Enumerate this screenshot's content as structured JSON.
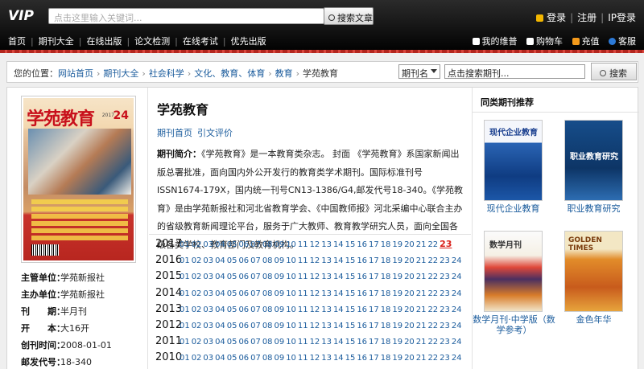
{
  "header": {
    "logo_text": "VIP",
    "search_placeholder": "点击这里输入关键词...",
    "search_button": "搜索文章",
    "login": "登录",
    "register": "注册",
    "ip_login": "IP登录"
  },
  "nav": {
    "items": [
      "首页",
      "期刊大全",
      "在线出版",
      "论文检测",
      "在线考试",
      "优先出版"
    ],
    "right": [
      "我的维普",
      "购物车",
      "充值",
      "客服"
    ],
    "right_icon_colors": [
      "#ffffff",
      "#ffffff",
      "#f59a1b",
      "#2c79d6"
    ]
  },
  "breadcrumb": {
    "prefix": "您的位置：",
    "links": [
      "网站首页",
      "期刊大全",
      "社会科学",
      "文化、教育、体育",
      "教育"
    ],
    "current": "学苑教育"
  },
  "search2": {
    "select_value": "期刊名",
    "input_value": "点击搜索期刊...",
    "button": "搜索"
  },
  "cover": {
    "title": "学苑教育",
    "issue_number": "24",
    "year": "2017"
  },
  "meta": [
    {
      "key": "主管单位：",
      "value": "学苑新报社"
    },
    {
      "key": "主办单位：",
      "value": "学苑新报社"
    },
    {
      "key": "刊　　期：",
      "value": "半月刊"
    },
    {
      "key": "开　　本：",
      "value": "大16开"
    },
    {
      "key": "创刊时间：",
      "value": "2008-01-01"
    },
    {
      "key": "邮发代号：",
      "value": "18-340"
    }
  ],
  "journal": {
    "title": "学苑教育",
    "link_home": "期刊首页",
    "link_cite": "引文评价",
    "intro_label": "期刊简介：",
    "intro_text": "《学苑教育》是一本教育类杂志。 封面 《学苑教育》系国家新闻出版总署批准，面向国内外公开发行的教育类学术期刊。国际标准刊号ISSN1674-179X，国内统一刊号CN13-1386/G4,邮发代号18-340。《学苑教育》是由学苑新报社和河北省教育学会、《中国教师报》河北采编中心联合主办的省级教育新闻理论平台，服务于广大教师、教育教学研究人员，面向全国各级各类学校、教育部门及教育机构。"
  },
  "years": [
    {
      "year": "2017",
      "issues": [
        "01",
        "02",
        "03",
        "04",
        "05",
        "06",
        "07",
        "08",
        "09",
        "10",
        "11",
        "12",
        "13",
        "14",
        "15",
        "16",
        "17",
        "18",
        "19",
        "20",
        "21",
        "22",
        "23"
      ],
      "current": "23"
    },
    {
      "year": "2016",
      "issues": [
        "01",
        "02",
        "03",
        "04",
        "05",
        "06",
        "07",
        "08",
        "09",
        "10",
        "11",
        "12",
        "13",
        "14",
        "15",
        "16",
        "17",
        "18",
        "19",
        "20",
        "21",
        "22",
        "23",
        "24"
      ]
    },
    {
      "year": "2015",
      "issues": [
        "01",
        "02",
        "03",
        "04",
        "05",
        "06",
        "07",
        "08",
        "09",
        "10",
        "11",
        "12",
        "13",
        "14",
        "15",
        "16",
        "17",
        "18",
        "19",
        "20",
        "21",
        "22",
        "23",
        "24"
      ]
    },
    {
      "year": "2014",
      "issues": [
        "01",
        "02",
        "03",
        "04",
        "05",
        "06",
        "07",
        "08",
        "09",
        "10",
        "11",
        "12",
        "13",
        "14",
        "15",
        "16",
        "17",
        "18",
        "19",
        "20",
        "21",
        "22",
        "23",
        "24"
      ]
    },
    {
      "year": "2013",
      "issues": [
        "01",
        "02",
        "03",
        "04",
        "05",
        "06",
        "07",
        "08",
        "09",
        "10",
        "11",
        "12",
        "13",
        "14",
        "15",
        "16",
        "17",
        "18",
        "19",
        "20",
        "21",
        "22",
        "23",
        "24"
      ]
    },
    {
      "year": "2012",
      "issues": [
        "01",
        "02",
        "03",
        "04",
        "05",
        "06",
        "07",
        "08",
        "09",
        "10",
        "11",
        "12",
        "13",
        "14",
        "15",
        "16",
        "17",
        "18",
        "19",
        "20",
        "21",
        "22",
        "23",
        "24"
      ]
    },
    {
      "year": "2011",
      "issues": [
        "01",
        "02",
        "03",
        "04",
        "05",
        "06",
        "07",
        "08",
        "09",
        "10",
        "11",
        "12",
        "13",
        "14",
        "15",
        "16",
        "17",
        "18",
        "19",
        "20",
        "21",
        "22",
        "23",
        "24"
      ]
    },
    {
      "year": "2010",
      "issues": [
        "01",
        "02",
        "03",
        "04",
        "05",
        "06",
        "07",
        "08",
        "09",
        "10",
        "11",
        "12",
        "13",
        "14",
        "15",
        "16",
        "17",
        "18",
        "19",
        "20",
        "21",
        "22",
        "23",
        "24"
      ]
    }
  ],
  "recommend": {
    "heading": "同类期刊推荐",
    "items": [
      {
        "name": "现代企业教育",
        "cover_text": "现代企业教育"
      },
      {
        "name": "职业教育研究",
        "cover_text": "职业教育研究"
      },
      {
        "name": "数学月刊·中学版（数学参考）",
        "cover_text": "数学月刊"
      },
      {
        "name": "金色年华",
        "cover_text": "GOLDEN TIMES"
      }
    ]
  }
}
